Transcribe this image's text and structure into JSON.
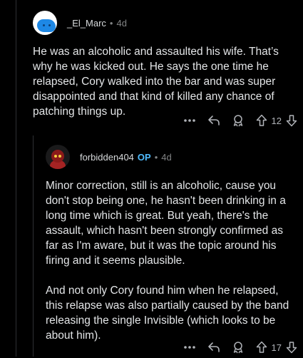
{
  "comments": [
    {
      "username": "_El_Marc",
      "separator": "•",
      "age": "4d",
      "lines": [
        "He was an alcoholic and assaulted his wife. That’s why he was kicked out. He says the one time he relapsed, Cory walked into the bar and was super disappointed and that kind of killed any chance of patching things up."
      ],
      "score": "12",
      "icons": [
        "more-icon",
        "reply-icon",
        "award-icon",
        "upvote-icon",
        "downvote-icon"
      ]
    },
    {
      "username": "forbidden404",
      "op_badge": "OP",
      "separator": "•",
      "age": "4d",
      "paragraphs": [
        "Minor correction, still is an alcoholic, cause you don't stop being one, he hasn't been drinking in a long time which is great. But yeah, there's the assault, which hasn't been strongly confirmed as far as I'm aware, but it was the topic around his firing and it seems plausible.",
        "And not only Cory found him when he relapsed, this relapse was also partially caused by the band releasing the single Invisible (which looks to be about him)."
      ],
      "score": "17",
      "icons": [
        "more-icon",
        "reply-icon",
        "award-icon",
        "upvote-icon",
        "downvote-icon"
      ]
    }
  ],
  "colors": {
    "background": "#000000",
    "text": "#e3e5e7",
    "meta": "#818384",
    "op": "#4fbcff"
  }
}
